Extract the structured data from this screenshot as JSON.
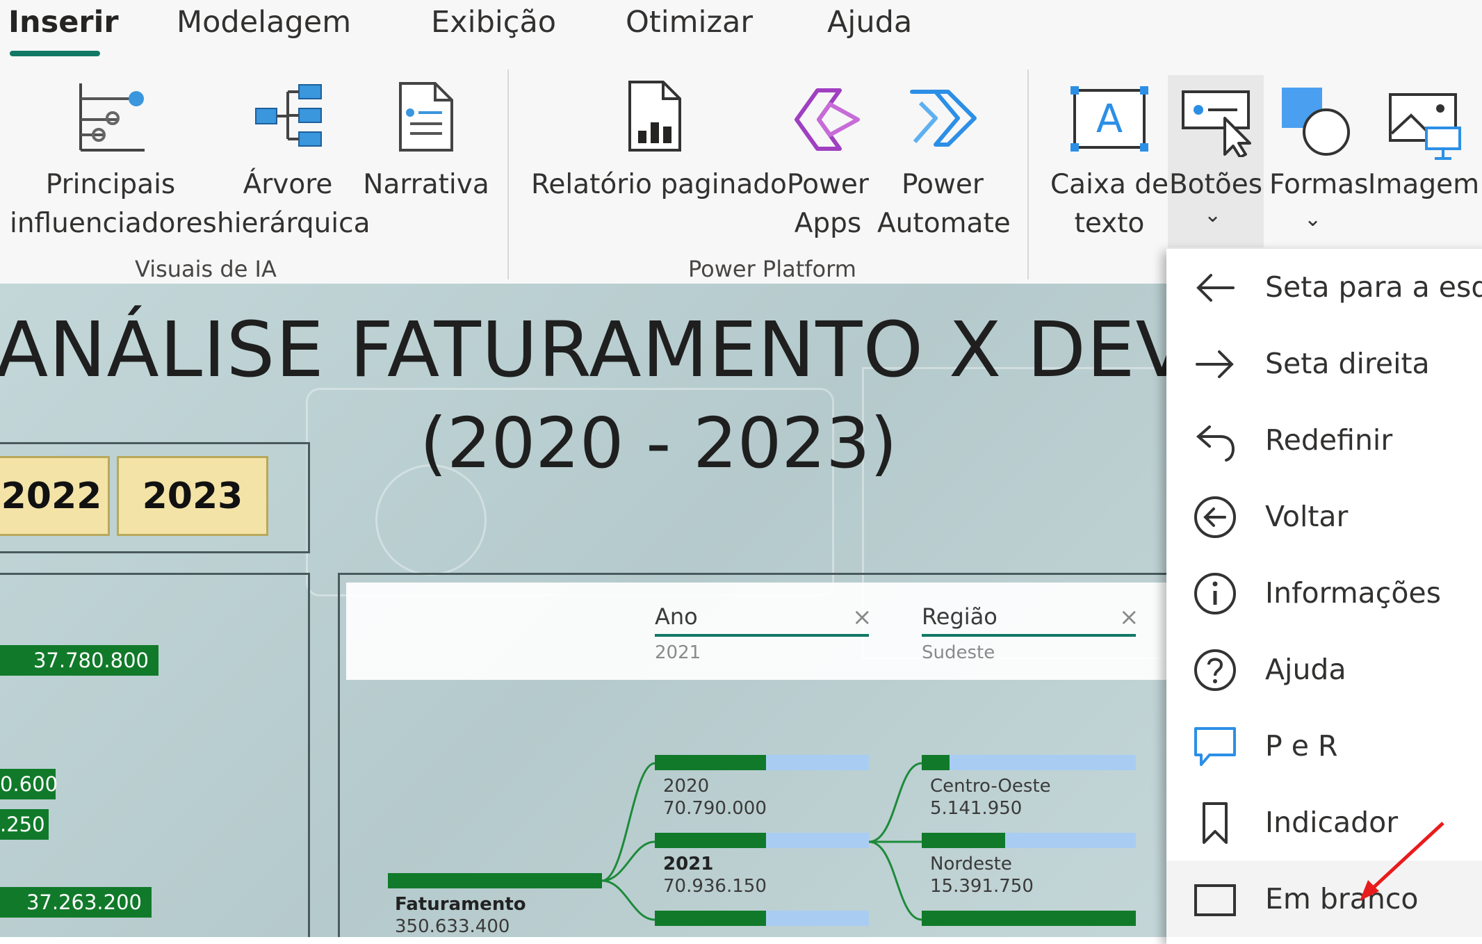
{
  "tabs": [
    {
      "label": "Inserir",
      "active": true
    },
    {
      "label": "Modelagem"
    },
    {
      "label": "Exibição"
    },
    {
      "label": "Otimizar"
    },
    {
      "label": "Ajuda"
    }
  ],
  "ribbon": {
    "ai_group": {
      "label": "Visuais de IA",
      "buttons": [
        {
          "line1": "Principais",
          "line2": "influenciadores",
          "icon": "key-influencers-icon"
        },
        {
          "line1": "Árvore",
          "line2": "hierárquica",
          "icon": "decomposition-tree-icon"
        },
        {
          "line1": "Narrativa",
          "line2": "",
          "icon": "narrative-icon"
        }
      ]
    },
    "power_group": {
      "label": "Power Platform",
      "buttons": [
        {
          "line1": "Relatório paginado",
          "line2": "",
          "icon": "paginated-report-icon"
        },
        {
          "line1": "Power",
          "line2": "Apps",
          "icon": "power-apps-icon"
        },
        {
          "line1": "Power",
          "line2": "Automate",
          "icon": "power-automate-icon"
        }
      ]
    },
    "elements_group": {
      "buttons": [
        {
          "line1": "Caixa de",
          "line2": "texto",
          "icon": "text-box-icon"
        },
        {
          "line1": "Botões",
          "line2": "",
          "icon": "buttons-icon",
          "dropdown": true,
          "active": true
        },
        {
          "line1": "Formas",
          "line2": "",
          "icon": "shapes-icon",
          "dropdown": true
        },
        {
          "line1": "Imagem",
          "line2": "",
          "icon": "image-icon"
        }
      ]
    }
  },
  "report": {
    "title_line1": "ANÁLISE FATURAMENTO X DEVOLUÇÕ",
    "title_line2": "(2020 - 2023)",
    "year_buttons": [
      "2022",
      "2023"
    ],
    "left_values": [
      "37.780.800",
      "0.600",
      ".250",
      "37.263.200"
    ],
    "filters": [
      {
        "name": "Ano",
        "value": "2021"
      },
      {
        "name": "Região",
        "value": "Sudeste"
      }
    ],
    "root": {
      "name": "Faturamento",
      "value": "350.633.400"
    },
    "year_nodes": [
      {
        "label": "2020",
        "value": "70.790.000",
        "fill": 0.52,
        "bold": false
      },
      {
        "label": "2021",
        "value": "70.936.150",
        "fill": 0.52,
        "bold": true
      },
      {
        "label": "",
        "value": "",
        "fill": 0.52,
        "bold": false
      }
    ],
    "region_nodes": [
      {
        "label": "Centro-Oeste",
        "value": "5.141.950",
        "fill": 0.13
      },
      {
        "label": "Nordeste",
        "value": "15.391.750",
        "fill": 0.39
      },
      {
        "label": "",
        "value": "",
        "fill": 1.0
      }
    ]
  },
  "dropdown": {
    "items": [
      {
        "label": "Seta para a esque",
        "icon": "arrow-left-icon"
      },
      {
        "label": "Seta direita",
        "icon": "arrow-right-icon"
      },
      {
        "label": "Redefinir",
        "icon": "reset-icon"
      },
      {
        "label": "Voltar",
        "icon": "back-circle-icon"
      },
      {
        "label": "Informações",
        "icon": "info-icon"
      },
      {
        "label": "Ajuda",
        "icon": "help-icon"
      },
      {
        "label": "P e R",
        "icon": "qa-icon"
      },
      {
        "label": "Indicador",
        "icon": "bookmark-icon"
      },
      {
        "label": "Em branco",
        "icon": "blank-icon",
        "highlighted": true
      }
    ]
  },
  "colors": {
    "accent": "#117865",
    "bar_green": "#117a2a",
    "bar_blue": "#a9cdf2",
    "slicer_yellow": "#f3e3a6",
    "annotation_red": "#e81c1c"
  }
}
